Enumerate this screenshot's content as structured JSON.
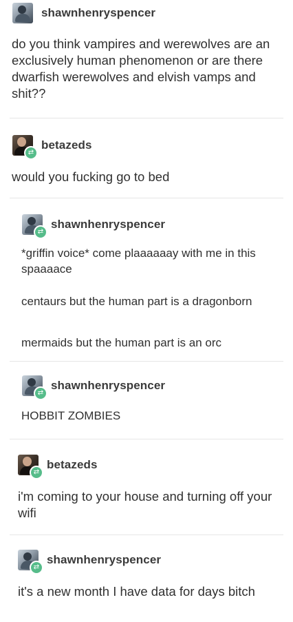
{
  "posts": [
    {
      "username": "shawnhenryspencer",
      "avatar_icon": "user-avatar-shawnhenryspencer",
      "reblog": false,
      "paragraphs": [
        "do you think vampires and werewolves are an exclusively human phenomenon or are there dwarfish werewolves and elvish vamps and shit??"
      ]
    },
    {
      "username": "betazeds",
      "avatar_icon": "user-avatar-betazeds",
      "reblog": true,
      "paragraphs": [
        "would you fucking go to bed"
      ]
    },
    {
      "username": "shawnhenryspencer",
      "avatar_icon": "user-avatar-shawnhenryspencer",
      "reblog": true,
      "paragraphs": [
        "*griffin voice* come plaaaaaay with me in this spaaaace",
        "centaurs but the human part is a dragonborn",
        "mermaids but the human part is an orc"
      ]
    },
    {
      "username": "shawnhenryspencer",
      "avatar_icon": "user-avatar-shawnhenryspencer",
      "reblog": true,
      "paragraphs": [
        "HOBBIT ZOMBIES"
      ]
    },
    {
      "username": "betazeds",
      "avatar_icon": "user-avatar-betazeds",
      "reblog": true,
      "paragraphs": [
        "i'm coming to your house and turning off your wifi"
      ]
    },
    {
      "username": "shawnhenryspencer",
      "avatar_icon": "user-avatar-shawnhenryspencer",
      "reblog": true,
      "paragraphs": [
        "it's a new month I have data for days bitch"
      ]
    }
  ],
  "reblog_symbol": "⇄",
  "colors": {
    "reblog_badge": "#56bc8a",
    "username": "#3a3a3a",
    "text": "#303030",
    "divider": "#e6e6e6"
  }
}
